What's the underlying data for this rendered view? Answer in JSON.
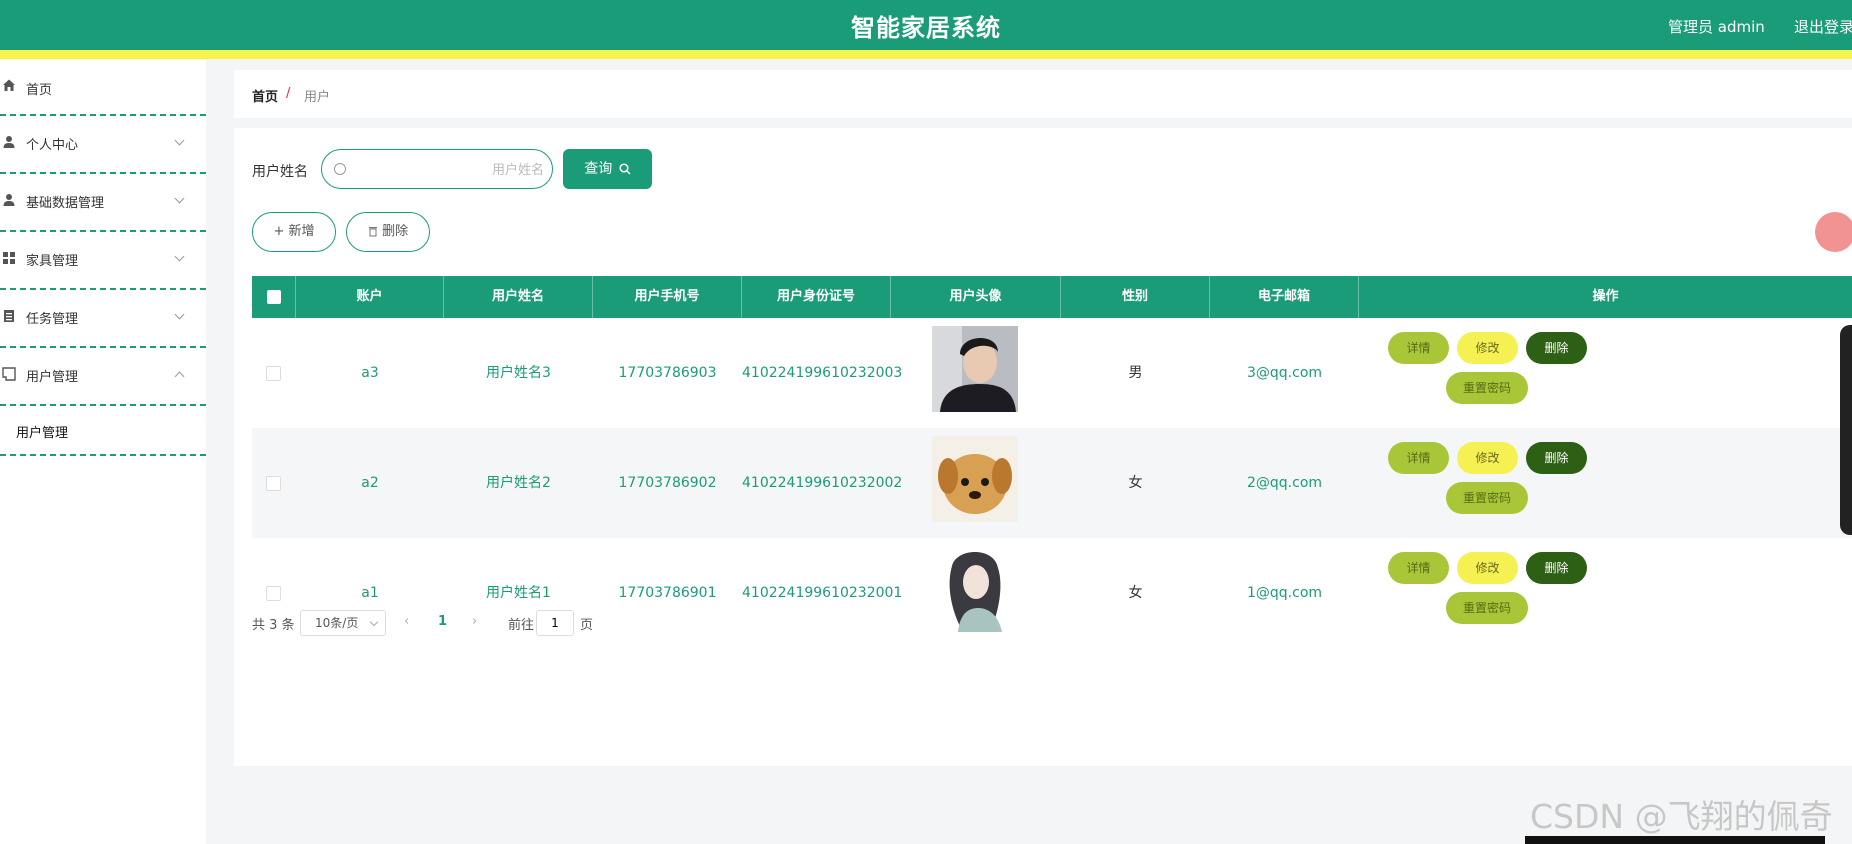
{
  "header": {
    "title": "智能家居系统",
    "admin_label": "管理员 admin",
    "logout_label": "退出登录",
    "colors": {
      "primary": "#1b9c79",
      "accent_bar": "#f6f44c"
    }
  },
  "sidebar": {
    "items": [
      {
        "label": "首页",
        "icon": "home-icon"
      },
      {
        "label": "个人中心",
        "icon": "user-icon"
      },
      {
        "label": "基础数据管理",
        "icon": "user-icon"
      },
      {
        "label": "家具管理",
        "icon": "grid-icon"
      },
      {
        "label": "任务管理",
        "icon": "clipboard-icon"
      },
      {
        "label": "用户管理",
        "icon": "user-square-icon"
      }
    ],
    "submenu": [
      "用户管理"
    ]
  },
  "breadcrumb": {
    "home": "首页",
    "separator": "/",
    "current": "用户"
  },
  "search": {
    "label": "用户姓名",
    "placeholder": "用户姓名",
    "value": "",
    "query_button": "查询"
  },
  "actions": {
    "add": "新增",
    "delete": "删除"
  },
  "table": {
    "headers": [
      "账户",
      "用户姓名",
      "用户手机号",
      "用户身份证号",
      "用户头像",
      "性别",
      "电子邮箱",
      "操作"
    ],
    "rows": [
      {
        "account": "a3",
        "name": "用户姓名3",
        "phone": "17703786903",
        "id_card": "410224199610232003",
        "avatar": "young-man-photo",
        "gender": "男",
        "email": "3@qq.com"
      },
      {
        "account": "a2",
        "name": "用户姓名2",
        "phone": "17703786902",
        "id_card": "410224199610232002",
        "avatar": "puppy-photo",
        "gender": "女",
        "email": "2@qq.com"
      },
      {
        "account": "a1",
        "name": "用户姓名1",
        "phone": "17703786901",
        "id_card": "410224199610232001",
        "avatar": "anime-girl-illustration",
        "gender": "女",
        "email": "1@qq.com"
      }
    ],
    "op_labels": {
      "detail": "详情",
      "edit": "修改",
      "delete": "删除",
      "reset": "重置密码"
    }
  },
  "pagination": {
    "total": "共 3 条",
    "page_size": "10条/页",
    "current_page": "1",
    "goto_label": "前往",
    "goto_value": "1",
    "page_unit": "页"
  },
  "watermark": "CSDN @飞翔的佩奇"
}
